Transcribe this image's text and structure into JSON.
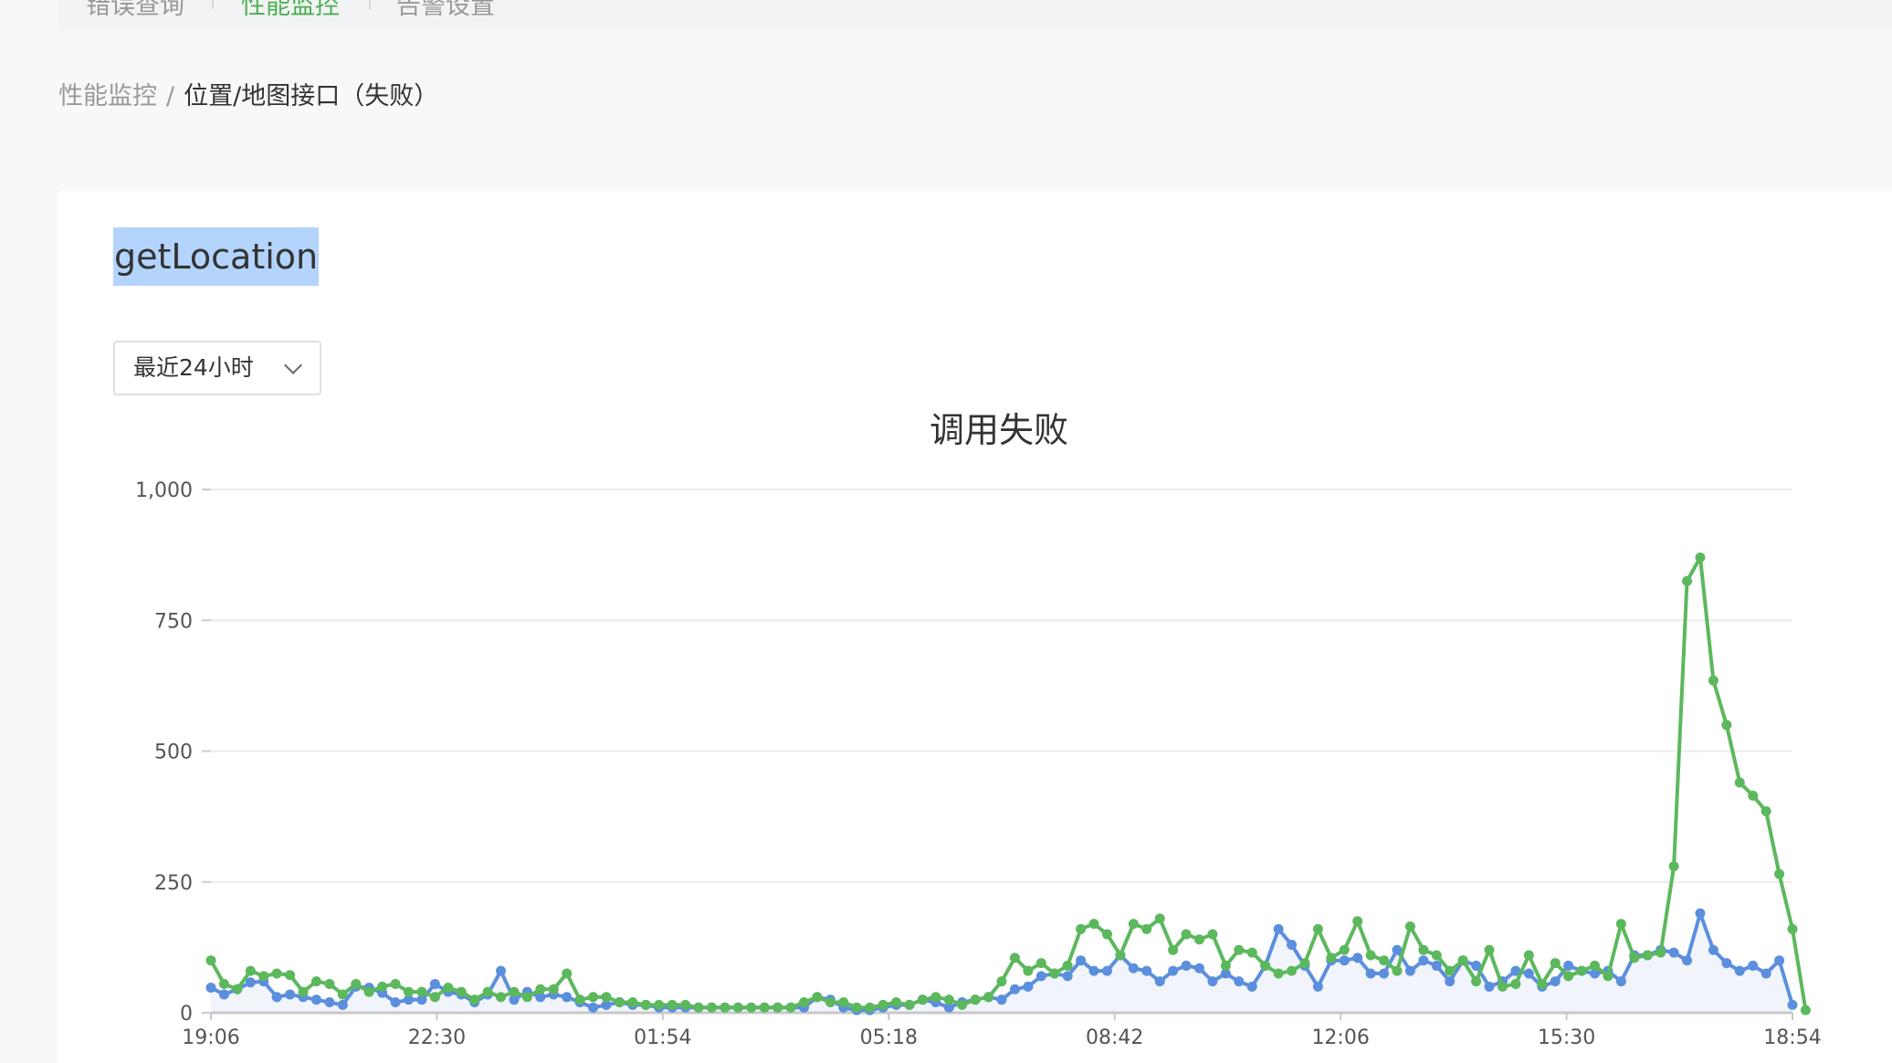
{
  "nav": {
    "items": [
      "错误查询",
      "性能监控",
      "告警设置"
    ],
    "active_index": 1,
    "active_color": "#4caf50"
  },
  "breadcrumb": {
    "parent": "性能监控",
    "separator": "/",
    "current": "位置/地图接口（失败）"
  },
  "page_title": "getLocation",
  "time_range": {
    "selected": "最近24小时"
  },
  "chart_data": {
    "type": "line",
    "title": "调用失败",
    "xlabel": "",
    "ylabel": "",
    "ylim": [
      0,
      1000
    ],
    "yticks": [
      0,
      250,
      500,
      750,
      1000
    ],
    "ytick_labels": [
      "0",
      "250",
      "500",
      "750",
      "1,000"
    ],
    "xtick_labels": [
      "19:06",
      "22:30",
      "01:54",
      "05:18",
      "08:42",
      "12:06",
      "15:30",
      "18:54"
    ],
    "x_count": 121,
    "grid": true,
    "area_fill": true,
    "colors": {
      "blue": "#5b8fde",
      "green": "#5cb85c",
      "area": "#f1f4fa"
    },
    "series": [
      {
        "color": "#5b8fde",
        "values": [
          48,
          35,
          45,
          58,
          60,
          30,
          35,
          30,
          25,
          20,
          15,
          50,
          48,
          38,
          20,
          25,
          25,
          55,
          40,
          35,
          20,
          35,
          80,
          25,
          40,
          30,
          35,
          30,
          20,
          10,
          15,
          20,
          15,
          15,
          10,
          10,
          10,
          10,
          10,
          10,
          10,
          10,
          10,
          10,
          10,
          10,
          30,
          25,
          10,
          5,
          5,
          10,
          15,
          15,
          25,
          20,
          10,
          20,
          25,
          30,
          25,
          45,
          50,
          70,
          75,
          70,
          100,
          80,
          80,
          110,
          85,
          80,
          60,
          80,
          90,
          85,
          60,
          75,
          60,
          50,
          90,
          160,
          130,
          90,
          50,
          100,
          100,
          105,
          75,
          75,
          120,
          80,
          100,
          90,
          60,
          100,
          90,
          50,
          60,
          80,
          75,
          50,
          60,
          90,
          80,
          75,
          80,
          60,
          110,
          110,
          120,
          115,
          100,
          190,
          120,
          95,
          80,
          90,
          75,
          100,
          15
        ]
      },
      {
        "color": "#5cb85c",
        "values": [
          100,
          55,
          45,
          80,
          70,
          75,
          72,
          40,
          60,
          55,
          35,
          55,
          40,
          50,
          55,
          40,
          40,
          30,
          48,
          40,
          25,
          40,
          30,
          40,
          30,
          45,
          45,
          75,
          25,
          30,
          30,
          20,
          20,
          15,
          15,
          15,
          15,
          10,
          10,
          10,
          10,
          10,
          10,
          10,
          10,
          20,
          30,
          20,
          20,
          10,
          10,
          15,
          20,
          15,
          25,
          30,
          25,
          15,
          25,
          30,
          60,
          105,
          80,
          95,
          75,
          90,
          160,
          170,
          150,
          110,
          170,
          160,
          180,
          120,
          150,
          140,
          150,
          90,
          120,
          115,
          90,
          75,
          80,
          95,
          160,
          105,
          120,
          175,
          110,
          100,
          80,
          165,
          120,
          110,
          80,
          100,
          60,
          120,
          50,
          55,
          110,
          55,
          95,
          70,
          80,
          90,
          70,
          170,
          105,
          110,
          115,
          280,
          825,
          870,
          635,
          550,
          440,
          415,
          385,
          265,
          160,
          5
        ]
      }
    ]
  }
}
